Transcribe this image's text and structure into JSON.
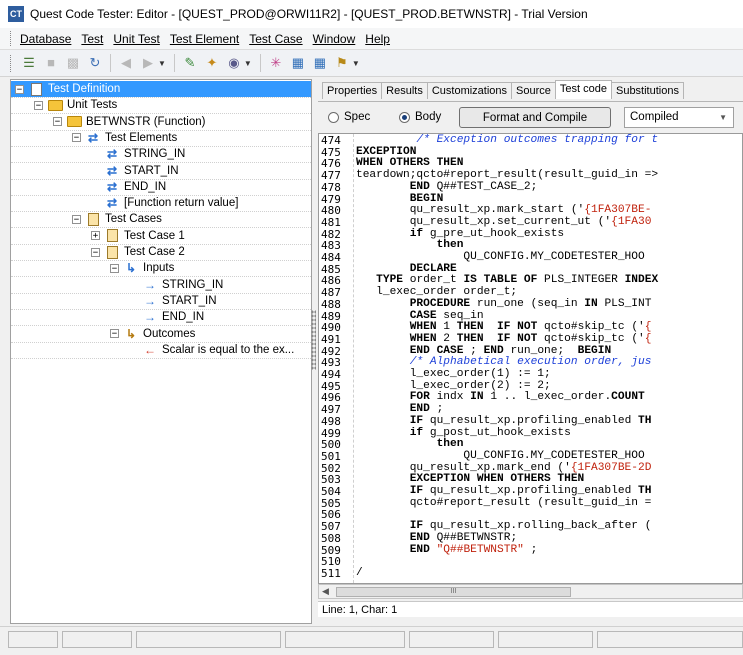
{
  "window": {
    "title": "Quest Code Tester: Editor - [QUEST_PROD@ORWI11R2] - [QUEST_PROD.BETWNSTR] - Trial Version",
    "app_icon_text": "CT"
  },
  "menu": [
    "Database",
    "Test",
    "Unit Test",
    "Test Element",
    "Test Case",
    "Window",
    "Help"
  ],
  "toolbar": {
    "icons": [
      "run-icon",
      "save-icon",
      "save-all-icon",
      "refresh-icon",
      "back-icon",
      "forward-icon",
      "edit-icon",
      "wand-icon",
      "view-icon",
      "gear-icon",
      "grid-icon",
      "grid2-icon",
      "tools-icon"
    ]
  },
  "tree": [
    {
      "label": "Test Definition",
      "level": 0,
      "expander": "−",
      "icon": "doc",
      "selected": true
    },
    {
      "label": "Unit Tests",
      "level": 1,
      "expander": "−",
      "icon": "folder"
    },
    {
      "label": "BETWNSTR (Function)",
      "level": 2,
      "expander": "−",
      "icon": "folder"
    },
    {
      "label": "Test Elements",
      "level": 3,
      "expander": "−",
      "icon": "swap"
    },
    {
      "label": "STRING_IN",
      "level": 4,
      "expander": "",
      "icon": "swap"
    },
    {
      "label": "START_IN",
      "level": 4,
      "expander": "",
      "icon": "swap"
    },
    {
      "label": "END_IN",
      "level": 4,
      "expander": "",
      "icon": "swap"
    },
    {
      "label": "[Function return value]",
      "level": 4,
      "expander": "",
      "icon": "swap"
    },
    {
      "label": "Test Cases",
      "level": 3,
      "expander": "−",
      "icon": "clip"
    },
    {
      "label": "Test Case 1",
      "level": 4,
      "expander": "+",
      "icon": "clip"
    },
    {
      "label": "Test Case 2",
      "level": 4,
      "expander": "−",
      "icon": "clip"
    },
    {
      "label": "Inputs",
      "level": 5,
      "expander": "−",
      "icon": "in"
    },
    {
      "label": "STRING_IN",
      "level": 6,
      "expander": "",
      "icon": "arrow"
    },
    {
      "label": "START_IN",
      "level": 6,
      "expander": "",
      "icon": "arrow"
    },
    {
      "label": "END_IN",
      "level": 6,
      "expander": "",
      "icon": "arrow"
    },
    {
      "label": "Outcomes",
      "level": 5,
      "expander": "−",
      "icon": "out"
    },
    {
      "label": "Scalar is equal to the ex...",
      "level": 6,
      "expander": "",
      "icon": "red"
    }
  ],
  "tabs": [
    "Properties",
    "Results",
    "Customizations",
    "Source",
    "Test code",
    "Substitutions"
  ],
  "active_tab": "Test code",
  "options": {
    "spec": "Spec",
    "body": "Body",
    "format_button": "Format and Compile",
    "compile_select": "Compiled"
  },
  "code": {
    "line_numbers": [
      "474",
      "475",
      "476",
      "477",
      "478",
      "479",
      "480",
      "481",
      "482",
      "483",
      "484",
      "485",
      "486",
      "487",
      "488",
      "489",
      "490",
      "491",
      "492",
      "493",
      "494",
      "495",
      "496",
      "497",
      "498",
      "499",
      "500",
      "501",
      "502",
      "503",
      "504",
      "505",
      "506",
      "507",
      "508",
      "509",
      "510",
      "511"
    ],
    "lines": [
      [
        [
          "cm",
          "         /* Exception outcomes trapping for t"
        ]
      ],
      [
        [
          "kw",
          "EXCEPTION"
        ]
      ],
      [
        [
          "kw",
          "WHEN OTHERS THEN"
        ]
      ],
      [
        [
          "",
          "teardown;qcto#report_result(result_guid_in =>"
        ]
      ],
      [
        [
          "",
          "        "
        ],
        [
          "kw",
          "END"
        ],
        [
          "",
          " Q##TEST_CASE_2;"
        ]
      ],
      [
        [
          "",
          "        "
        ],
        [
          "kw",
          "BEGIN"
        ]
      ],
      [
        [
          "",
          "        qu_result_xp.mark_start ('"
        ],
        [
          "st",
          "{1FA307BE-"
        ]
      ],
      [
        [
          "",
          "        qu_result_xp.set_current_ut ('"
        ],
        [
          "st",
          "{1FA30"
        ]
      ],
      [
        [
          "",
          "        "
        ],
        [
          "kw",
          "if"
        ],
        [
          "",
          " g_pre_ut_hook_exists"
        ]
      ],
      [
        [
          "",
          "            "
        ],
        [
          "kw",
          "then"
        ]
      ],
      [
        [
          "",
          "                QU_CONFIG.MY_CODETESTER_HOO"
        ]
      ],
      [
        [
          "",
          "        "
        ],
        [
          "kw",
          "DECLARE"
        ]
      ],
      [
        [
          "",
          "   "
        ],
        [
          "kw",
          "TYPE"
        ],
        [
          "",
          " order_t "
        ],
        [
          "kw",
          "IS TABLE OF"
        ],
        [
          "",
          " PLS_INTEGER "
        ],
        [
          "kw",
          "INDEX"
        ]
      ],
      [
        [
          "",
          "   l_exec_order order_t;"
        ]
      ],
      [
        [
          "",
          "        "
        ],
        [
          "kw",
          "PROCEDURE"
        ],
        [
          "",
          " run_one (seq_in "
        ],
        [
          "kw",
          "IN"
        ],
        [
          "",
          " PLS_INT"
        ]
      ],
      [
        [
          "",
          "        "
        ],
        [
          "kw",
          "CASE"
        ],
        [
          "",
          " seq_in"
        ]
      ],
      [
        [
          "",
          "        "
        ],
        [
          "kw",
          "WHEN"
        ],
        [
          "",
          " 1 "
        ],
        [
          "kw",
          "THEN"
        ],
        [
          "",
          "  "
        ],
        [
          "kw",
          "IF NOT"
        ],
        [
          "",
          " qcto#skip_tc ('"
        ],
        [
          "st",
          "{"
        ]
      ],
      [
        [
          "",
          "        "
        ],
        [
          "kw",
          "WHEN"
        ],
        [
          "",
          " 2 "
        ],
        [
          "kw",
          "THEN"
        ],
        [
          "",
          "  "
        ],
        [
          "kw",
          "IF NOT"
        ],
        [
          "",
          " qcto#skip_tc ('"
        ],
        [
          "st",
          "{"
        ]
      ],
      [
        [
          "",
          "        "
        ],
        [
          "kw",
          "END CASE"
        ],
        [
          "",
          " ; "
        ],
        [
          "kw",
          "END"
        ],
        [
          "",
          " run_one;  "
        ],
        [
          "kw",
          "BEGIN"
        ]
      ],
      [
        [
          "",
          "        "
        ],
        [
          "cm",
          "/* Alphabetical execution order, jus"
        ]
      ],
      [
        [
          "",
          "        l_exec_order(1) := 1;"
        ]
      ],
      [
        [
          "",
          "        l_exec_order(2) := 2;"
        ]
      ],
      [
        [
          "",
          "        "
        ],
        [
          "kw",
          "FOR"
        ],
        [
          "",
          " indx "
        ],
        [
          "kw",
          "IN"
        ],
        [
          "",
          " 1 .. l_exec_order."
        ],
        [
          "kw",
          "COUNT"
        ]
      ],
      [
        [
          "",
          "        "
        ],
        [
          "kw",
          "END"
        ],
        [
          "",
          " ;"
        ]
      ],
      [
        [
          "",
          "        "
        ],
        [
          "kw",
          "IF"
        ],
        [
          "",
          " qu_result_xp.profiling_enabled "
        ],
        [
          "kw",
          "TH"
        ]
      ],
      [
        [
          "",
          "        "
        ],
        [
          "kw",
          "if"
        ],
        [
          "",
          " g_post_ut_hook_exists"
        ]
      ],
      [
        [
          "",
          "            "
        ],
        [
          "kw",
          "then"
        ]
      ],
      [
        [
          "",
          "                QU_CONFIG.MY_CODETESTER_HOO"
        ]
      ],
      [
        [
          "",
          "        qu_result_xp.mark_end ('"
        ],
        [
          "st",
          "{1FA307BE-2D"
        ]
      ],
      [
        [
          "",
          "        "
        ],
        [
          "kw",
          "EXCEPTION WHEN OTHERS THEN"
        ]
      ],
      [
        [
          "",
          "        "
        ],
        [
          "kw",
          "IF"
        ],
        [
          "",
          " qu_result_xp.profiling_enabled "
        ],
        [
          "kw",
          "TH"
        ]
      ],
      [
        [
          "",
          "        qcto#report_result (result_guid_in ="
        ]
      ],
      [
        [
          "",
          ""
        ]
      ],
      [
        [
          "",
          "        "
        ],
        [
          "kw",
          "IF"
        ],
        [
          "",
          " qu_result_xp.rolling_back_after ("
        ]
      ],
      [
        [
          "",
          "        "
        ],
        [
          "kw",
          "END"
        ],
        [
          "",
          " Q##BETWNSTR;"
        ]
      ],
      [
        [
          "",
          "        "
        ],
        [
          "kw",
          "END"
        ],
        [
          "",
          " "
        ],
        [
          "st",
          "\"Q##BETWNSTR\""
        ],
        [
          "",
          " ;"
        ]
      ],
      [
        [
          "",
          ""
        ]
      ],
      [
        [
          "",
          "/"
        ]
      ]
    ]
  },
  "status": {
    "position": "Line: 1, Char: 1"
  },
  "scroll_thumb_text": "III"
}
